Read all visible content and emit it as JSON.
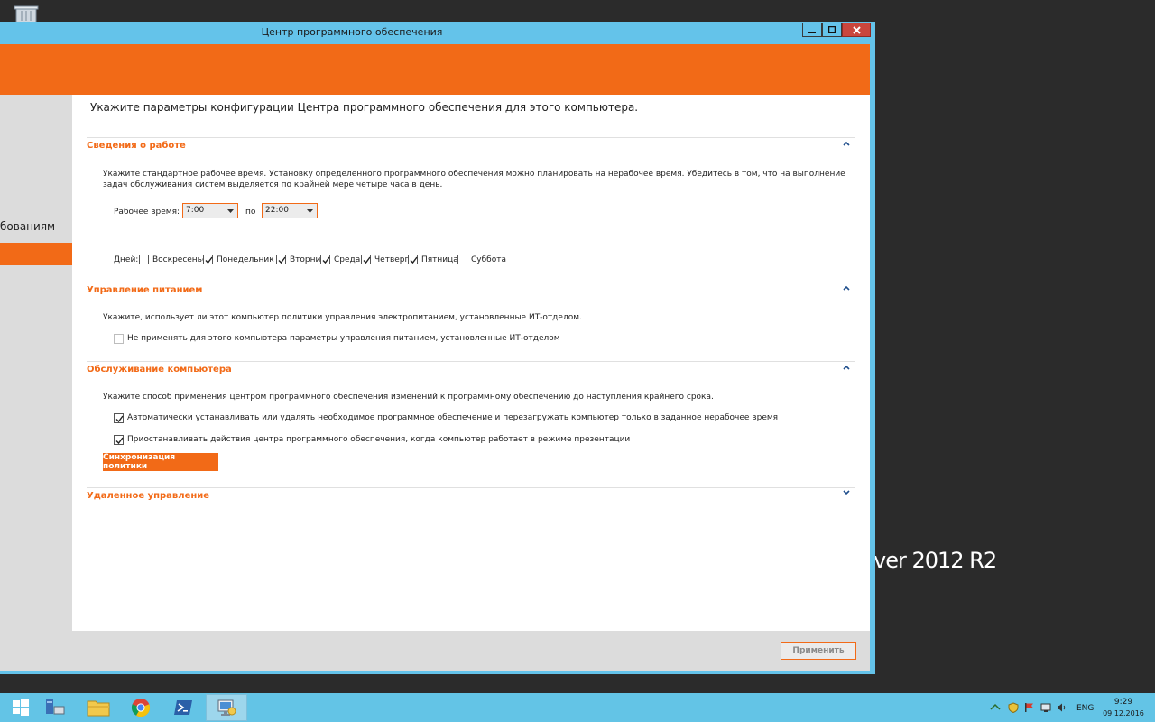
{
  "window": {
    "title": "Центр программного обеспечения"
  },
  "sidebar": {
    "visible_item": "бованиям"
  },
  "page": {
    "title": "Укажите параметры конфигурации Центра программного обеспечения для этого компьютера."
  },
  "work_info": {
    "title": "Сведения о работе",
    "description": "Укажите стандартное рабочее время. Установку определенного программного обеспечения можно планировать на нерабочее время. Убедитесь в том, что на выполнение задач обслуживания систем выделяется по крайней мере четыре часа в день.",
    "hours_label": "Рабочее время: с",
    "from_value": "7:00",
    "to_label": "по",
    "to_value": "22:00",
    "days_label": "Дней:",
    "days": [
      {
        "label": "Воскресенье",
        "checked": false
      },
      {
        "label": "Понедельник",
        "checked": true
      },
      {
        "label": "Вторник",
        "checked": true
      },
      {
        "label": "Среда",
        "checked": true
      },
      {
        "label": "Четверг",
        "checked": true
      },
      {
        "label": "Пятница",
        "checked": true
      },
      {
        "label": "Суббота",
        "checked": false
      }
    ]
  },
  "power": {
    "title": "Управление питанием",
    "description": "Укажите, использует ли этот компьютер политики управления электропитанием, установленные ИТ-отделом.",
    "option_label": "Не применять для этого компьютера параметры управления питанием, установленные ИТ-отделом",
    "option_checked": false
  },
  "maintenance": {
    "title": "Обслуживание компьютера",
    "description": "Укажите способ применения центром программного обеспечения изменений к программному обеспечению до наступления крайнего срока.",
    "option1_label": "Автоматически устанавливать или удалять необходимое программное обеспечение и перезагружать компьютер только в заданное нерабочее время",
    "option1_checked": true,
    "option2_label": "Приостанавливать действия центра программного обеспечения, когда компьютер работает в режиме презентации",
    "option2_checked": true,
    "sync_button": "Синхронизация политики"
  },
  "remote": {
    "title": "Удаленное управление"
  },
  "footer": {
    "apply_button": "Применить"
  },
  "desktop": {
    "wallpaper_text": "ver 2012 R2"
  },
  "taskbar": {
    "language": "ENG",
    "time": "9:29",
    "date": "09.12.2016"
  },
  "colors": {
    "accent": "#f26a17",
    "window_frame": "#64c3ea",
    "taskbar": "#63c4e6"
  }
}
